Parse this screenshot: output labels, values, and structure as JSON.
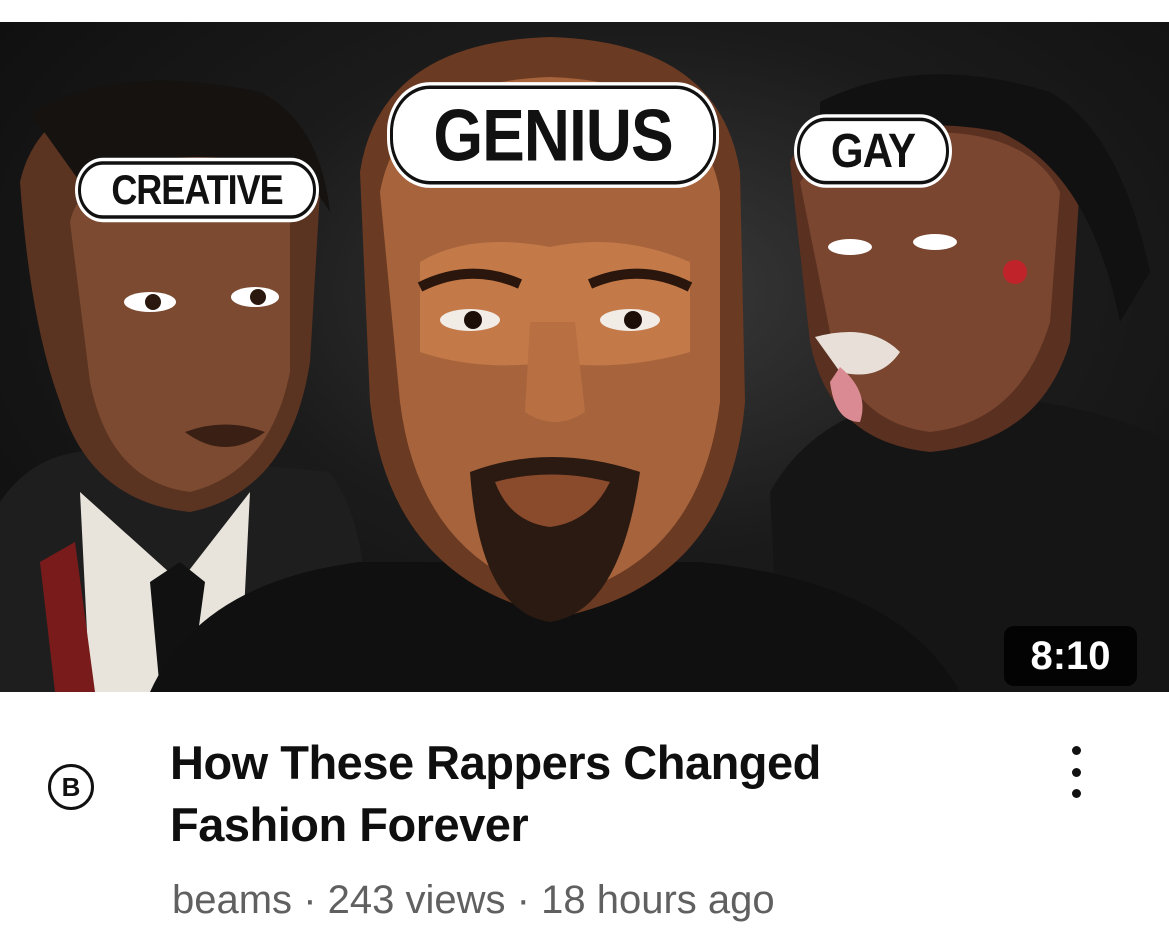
{
  "video": {
    "thumbnail": {
      "labels": {
        "left": "CREATIVE",
        "center": "GENIUS",
        "right": "GAY"
      },
      "duration": "8:10"
    },
    "channel_avatar_letter": "B",
    "title_line1": "How These Rappers Changed",
    "title_line2": "Fashion Forever",
    "channel": "beams",
    "views": "243 views",
    "age": "18 hours ago",
    "separator": "·",
    "menu_icon": "more-vertical-icon"
  },
  "colors": {
    "background": "#ffffff",
    "title": "#0f0f0f",
    "subtitle": "#606060",
    "duration_bg": "#000000"
  }
}
